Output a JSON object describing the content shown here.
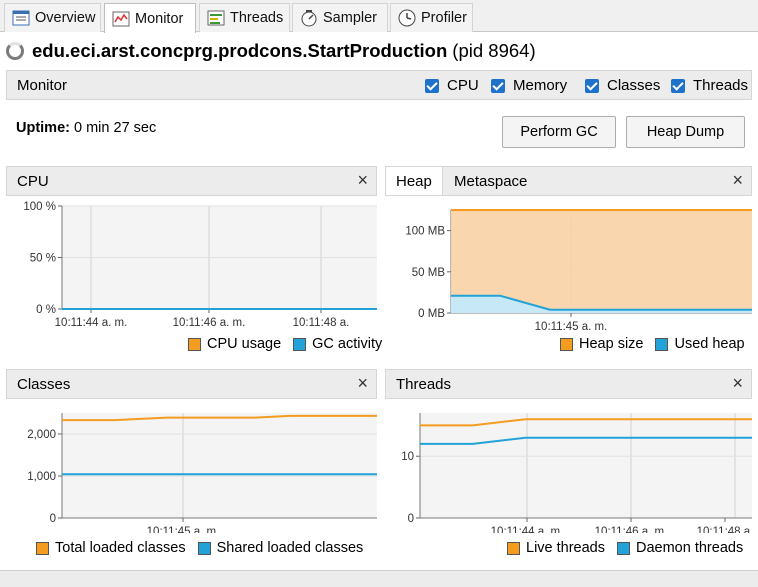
{
  "tabs": [
    {
      "label": "Overview",
      "icon": "overview-icon"
    },
    {
      "label": "Monitor",
      "icon": "monitor-icon"
    },
    {
      "label": "Threads",
      "icon": "threads-icon"
    },
    {
      "label": "Sampler",
      "icon": "sampler-icon"
    },
    {
      "label": "Profiler",
      "icon": "profiler-icon"
    }
  ],
  "active_tab": "Monitor",
  "title": {
    "app": "edu.eci.arst.concprg.prodcons.StartProduction",
    "pid": "(pid 8964)"
  },
  "monitor": {
    "label": "Monitor",
    "checks": [
      {
        "label": "CPU",
        "checked": true
      },
      {
        "label": "Memory",
        "checked": true
      },
      {
        "label": "Classes",
        "checked": true
      },
      {
        "label": "Threads",
        "checked": true
      }
    ]
  },
  "uptime": {
    "label": "Uptime:",
    "value": "0 min 27 sec"
  },
  "buttons": {
    "gc": "Perform GC",
    "heap_dump": "Heap Dump"
  },
  "colors": {
    "orange": "#f39c1f",
    "blue": "#23a2d8",
    "heap_fill": "#f9d3a6",
    "used_fill": "#c7e9f7"
  },
  "panels": {
    "cpu": {
      "title": "CPU",
      "close": "×",
      "legend": [
        "CPU usage",
        "GC activity"
      ]
    },
    "heap": {
      "tabs": [
        "Heap",
        "Metaspace"
      ],
      "close": "×",
      "legend": [
        "Heap size",
        "Used heap"
      ]
    },
    "classes": {
      "title": "Classes",
      "close": "×",
      "legend": [
        "Total loaded classes",
        "Shared loaded classes"
      ]
    },
    "threads": {
      "title": "Threads",
      "close": "×",
      "legend": [
        "Live threads",
        "Daemon threads"
      ]
    }
  },
  "chart_data": [
    {
      "type": "line",
      "ylabels": [
        "100 %",
        "50 %",
        "0 %"
      ],
      "yticks": [
        100,
        50,
        0
      ],
      "ylim": [
        0,
        100
      ],
      "xlabels": [
        "10:11:44 a. m.",
        "10:11:46 a. m.",
        "10:11:48 a."
      ],
      "series": [
        {
          "name": "CPU usage",
          "color": "#f39c1f",
          "values": [
            0,
            0,
            0,
            0
          ]
        },
        {
          "name": "GC activity",
          "color": "#23a2d8",
          "values": [
            0,
            0,
            0,
            0
          ]
        }
      ]
    },
    {
      "type": "area",
      "ylabels": [
        "100 MB",
        "50 MB",
        "0 MB"
      ],
      "yticks": [
        100,
        50,
        0
      ],
      "ylim": [
        0,
        125
      ],
      "xlabels": [
        "10:11:45 a. m."
      ],
      "series": [
        {
          "name": "Heap size",
          "color": "#f39c1f",
          "values": [
            125,
            125,
            125,
            125,
            125
          ]
        },
        {
          "name": "Used heap",
          "color": "#23a2d8",
          "values": [
            21,
            21,
            4,
            4,
            4
          ]
        }
      ]
    },
    {
      "type": "line",
      "ylabels": [
        "2,000",
        "1,000",
        "0"
      ],
      "yticks": [
        2000,
        1000,
        0
      ],
      "ylim": [
        0,
        2500
      ],
      "xlabels": [
        "10:11:45 a. m."
      ],
      "series": [
        {
          "name": "Total loaded classes",
          "color": "#f39c1f",
          "values": [
            2330,
            2330,
            2390,
            2390,
            2430,
            2430
          ]
        },
        {
          "name": "Shared loaded classes",
          "color": "#23a2d8",
          "values": [
            1040,
            1040,
            1040,
            1040,
            1040,
            1040
          ]
        }
      ]
    },
    {
      "type": "line",
      "ylabels": [
        "10",
        "0"
      ],
      "yticks": [
        10,
        0
      ],
      "ylim": [
        0,
        17
      ],
      "xlabels": [
        "10:11:44 a. m.",
        "10:11:46 a. m.",
        "10:11:48 a."
      ],
      "series": [
        {
          "name": "Live threads",
          "color": "#f39c1f",
          "values": [
            15,
            15,
            16,
            16,
            16,
            16
          ]
        },
        {
          "name": "Daemon threads",
          "color": "#23a2d8",
          "values": [
            12,
            12,
            13,
            13,
            13,
            13
          ]
        }
      ]
    }
  ]
}
